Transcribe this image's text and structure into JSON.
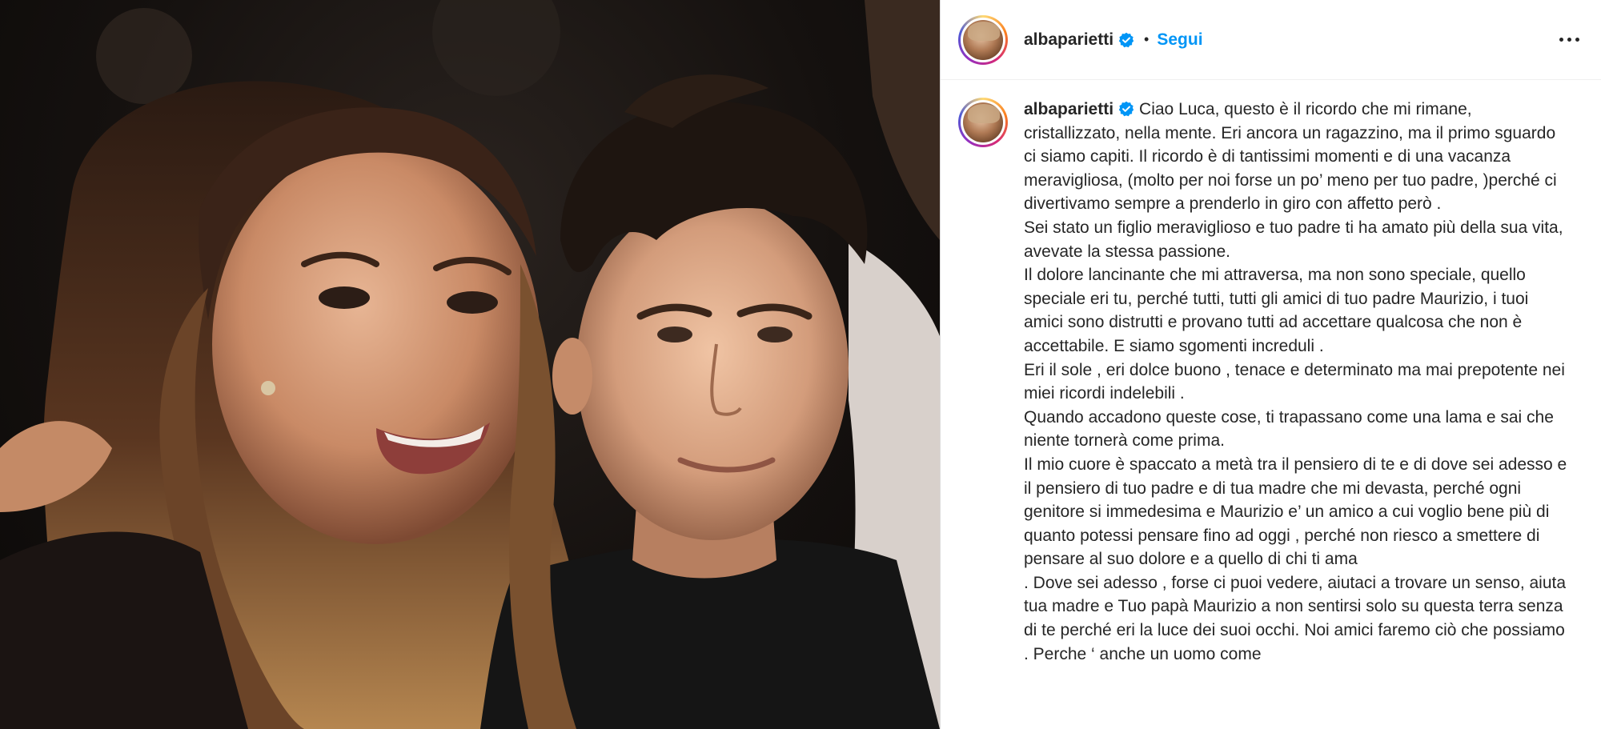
{
  "post": {
    "username": "albaparietti",
    "follow_label": "Segui",
    "separator": "•",
    "more_label": "Altre opzioni"
  },
  "caption": {
    "username": "albaparietti",
    "paragraphs": [
      "Ciao Luca, questo è il ricordo che mi rimane, cristallizzato, nella mente. Eri ancora un ragazzino, ma il primo sguardo ci siamo capiti. Il ricordo è di tantissimi momenti e di una vacanza meravigliosa, (molto per noi forse un po’ meno per tuo padre, )perché ci divertivamo sempre a prenderlo in giro con affetto però .",
      "Sei stato un figlio meraviglioso e tuo padre ti ha amato più della sua vita, avevate la stessa passione.",
      "Il dolore lancinante che mi attraversa, ma non sono speciale, quello speciale eri tu, perché tutti, tutti gli amici di tuo padre Maurizio, i tuoi amici sono distrutti e provano tutti ad accettare qualcosa che non è accettabile. E siamo sgomenti increduli .",
      "Eri il sole , eri dolce buono , tenace e determinato ma mai prepotente nei miei ricordi indelebili .",
      "Quando accadono queste cose, ti trapassano come una lama e sai che niente tornerà come prima.",
      "Il mio cuore è spaccato a metà tra il pensiero di te e di dove sei adesso e il pensiero di tuo padre e di tua madre che mi devasta, perché ogni genitore si immedesima e Maurizio e’ un amico a cui voglio bene più di quanto potessi pensare fino ad oggi , perché non riesco a smettere di pensare al suo dolore e a quello di chi ti ama",
      ". Dove sei adesso , forse ci puoi vedere, aiutaci a trovare un senso, aiuta tua madre e Tuo papà Maurizio a non sentirsi solo su questa terra senza di te perché eri la luce dei suoi occhi. Noi amici faremo ciò che possiamo . Perche ‘ anche un uomo come"
    ]
  },
  "colors": {
    "follow": "#0095f6",
    "verified": "#0095f6",
    "text": "#262626",
    "border": "#dbdbdb"
  },
  "icons": {
    "verified": "verified-badge-icon",
    "more": "more-options-icon"
  }
}
